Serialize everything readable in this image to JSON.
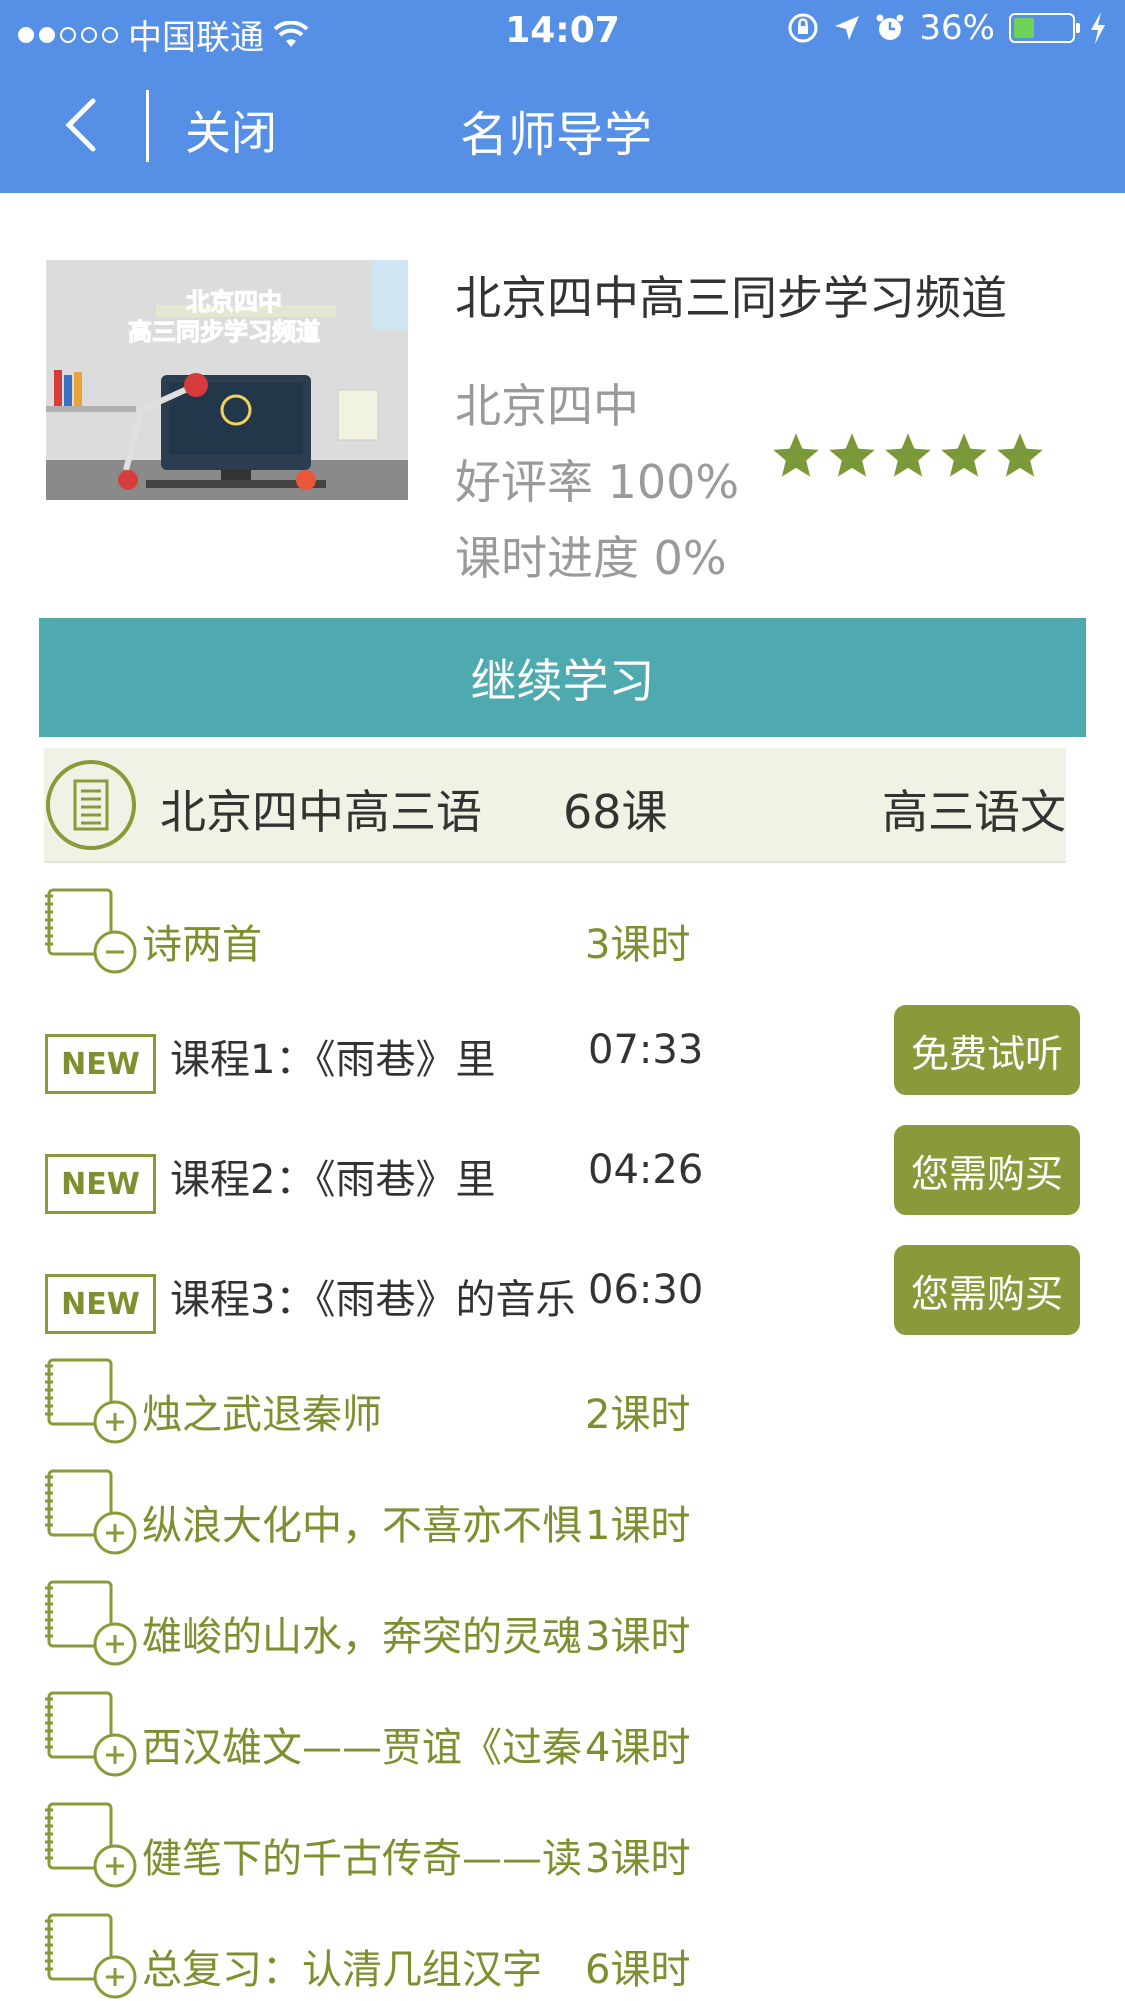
{
  "status_bar": {
    "carrier": "中国联通",
    "time": "14:07",
    "battery": "36%",
    "battery_level": 0.36,
    "signal_dots_filled": 2,
    "signal_dots_total": 5
  },
  "nav": {
    "close_label": "关闭",
    "title": "名师导学"
  },
  "course": {
    "thumbnail_caption": [
      "北京四中",
      "高三同步学习频道"
    ],
    "title": "北京四中高三同步学习频道",
    "school": "北京四中",
    "rating_text": "好评率 100%",
    "rating_stars": 5,
    "progress_text": "课时进度 0%"
  },
  "continue_label": "继续学习",
  "summary": {
    "name": "北京四中高三语",
    "count": "68课",
    "subject": "高三语文"
  },
  "chapters": [
    {
      "title": "诗两首",
      "hours": "3课时",
      "expanded": true,
      "lessons": [
        {
          "badge": "NEW",
          "title": "课程1：《雨巷》里",
          "time": "07:33",
          "action": "免费试听"
        },
        {
          "badge": "NEW",
          "title": "课程2：《雨巷》里",
          "time": "04:26",
          "action": "您需购买"
        },
        {
          "badge": "NEW",
          "title": "课程3：《雨巷》的音乐",
          "time": "06:30",
          "action": "您需购买"
        }
      ]
    },
    {
      "title": "烛之武退秦师",
      "hours": "2课时",
      "expanded": false
    },
    {
      "title": "纵浪大化中，不喜亦不惧",
      "hours": "1课时",
      "expanded": false
    },
    {
      "title": "雄峻的山水，奔突的灵魂",
      "hours": "3课时",
      "expanded": false
    },
    {
      "title": "西汉雄文——贾谊《过秦",
      "hours": "4课时",
      "expanded": false
    },
    {
      "title": "健笔下的千古传奇——读",
      "hours": "3课时",
      "expanded": false
    },
    {
      "title": "总复习：认清几组汉字",
      "hours": "6课时",
      "expanded": false
    }
  ],
  "colors": {
    "nav_bg": "#5590e6",
    "continue_bg": "#4eaaae",
    "accent_olive": "#8a9a3a",
    "chapter_text": "#7f8e2e",
    "star": "#7a9a3a"
  }
}
